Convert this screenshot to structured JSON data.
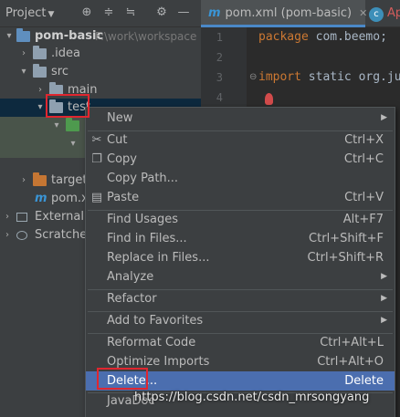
{
  "project": {
    "title": "Project",
    "tree": [
      {
        "label": "pom-basic",
        "path": "F:\\work\\workspace"
      },
      {
        "label": ".idea"
      },
      {
        "label": "src"
      },
      {
        "label": "main"
      },
      {
        "label": "test"
      },
      {
        "label": ""
      },
      {
        "label": ""
      },
      {
        "label": "target"
      },
      {
        "label": "pom.x"
      },
      {
        "label": "External L"
      },
      {
        "label": "Scratches"
      }
    ]
  },
  "editor": {
    "tabs": [
      {
        "label": "pom.xml (pom-basic)",
        "icon": "m-maven-icon"
      },
      {
        "label": "Ap",
        "icon": "class-c-icon"
      }
    ],
    "line_numbers": [
      "1",
      "2",
      "3",
      "4"
    ],
    "code": {
      "line1_kw": "package",
      "line1_rest": " com.beemo;",
      "line3_kw": "import",
      "line3_rest": " static org.ju"
    }
  },
  "context_menu": {
    "items": [
      {
        "label": "New",
        "shortcut": "",
        "submenu": true,
        "icon": ""
      },
      {
        "label": "Cut",
        "shortcut": "Ctrl+X",
        "icon": "scissors-icon"
      },
      {
        "label": "Copy",
        "shortcut": "Ctrl+C",
        "icon": "copy-icon"
      },
      {
        "label": "Copy Path...",
        "shortcut": "",
        "icon": ""
      },
      {
        "label": "Paste",
        "shortcut": "Ctrl+V",
        "icon": "clipboard-icon"
      },
      {
        "label": "Find Usages",
        "shortcut": "Alt+F7",
        "icon": ""
      },
      {
        "label": "Find in Files...",
        "shortcut": "Ctrl+Shift+F",
        "icon": ""
      },
      {
        "label": "Replace in Files...",
        "shortcut": "Ctrl+Shift+R",
        "icon": ""
      },
      {
        "label": "Analyze",
        "shortcut": "",
        "submenu": true,
        "icon": ""
      },
      {
        "label": "Refactor",
        "shortcut": "",
        "submenu": true,
        "icon": ""
      },
      {
        "label": "Add to Favorites",
        "shortcut": "",
        "submenu": true,
        "icon": ""
      },
      {
        "label": "Reformat Code",
        "shortcut": "Ctrl+Alt+L",
        "icon": ""
      },
      {
        "label": "Optimize Imports",
        "shortcut": "Ctrl+Alt+O",
        "icon": ""
      },
      {
        "label": "Delete...",
        "shortcut": "Delete",
        "icon": "",
        "highlighted": true
      },
      {
        "label": "JavaDoc",
        "shortcut": "",
        "icon": ""
      }
    ]
  },
  "watermark": "https://blog.csdn.net/csdn_mrsongyang",
  "colors": {
    "panel_bg": "#3c3f41",
    "editor_bg": "#2b2b2b",
    "highlight": "#4b6eaf",
    "annotation_red": "#e0262f"
  }
}
